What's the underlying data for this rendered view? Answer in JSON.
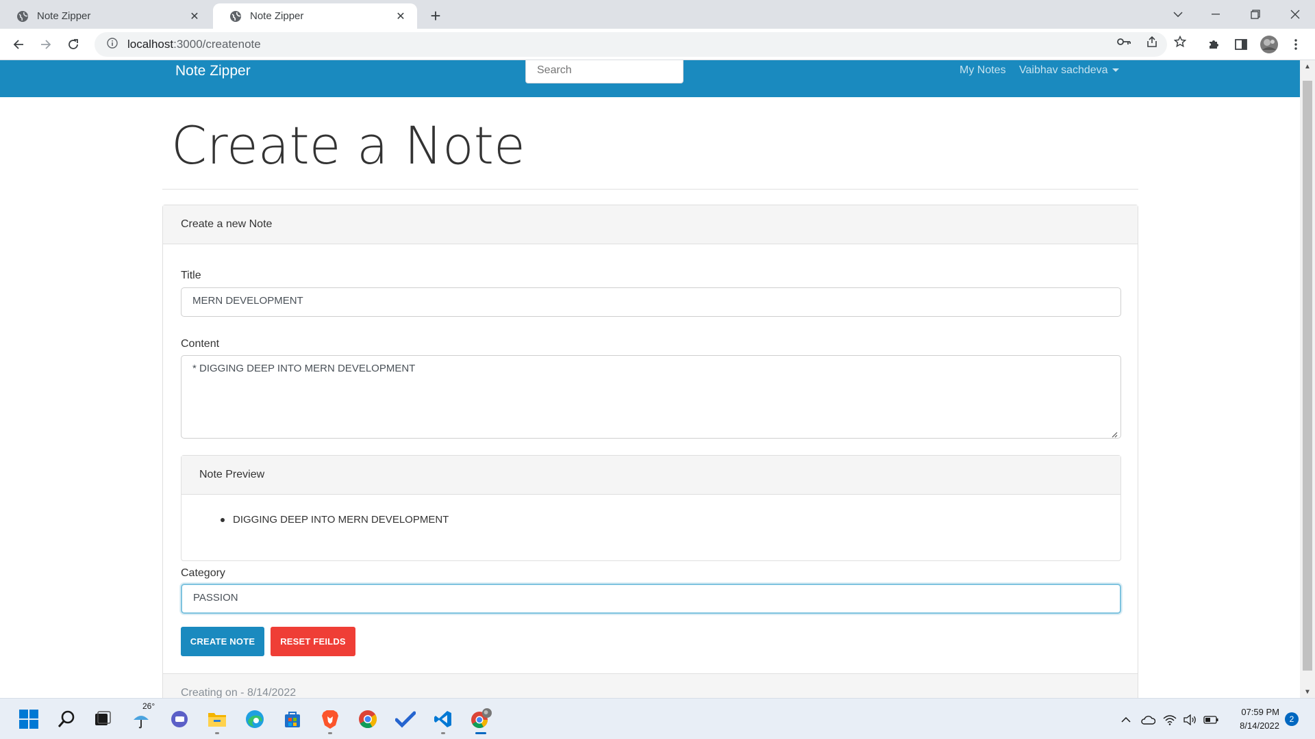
{
  "browser": {
    "tabs": [
      {
        "title": "Note Zipper",
        "active": false
      },
      {
        "title": "Note Zipper",
        "active": true
      }
    ],
    "url_host": "localhost",
    "url_path": ":3000/createnote"
  },
  "navbar": {
    "brand": "Note Zipper",
    "search_placeholder": "Search",
    "my_notes": "My Notes",
    "user_name": "Vaibhav sachdeva"
  },
  "page": {
    "title": "Create a Note",
    "card_header": "Create a new Note",
    "title_label": "Title",
    "title_value": "MERN DEVELOPMENT",
    "content_label": "Content",
    "content_value": "* DIGGING DEEP INTO MERN DEVELOPMENT",
    "preview_header": "Note Preview",
    "preview_items": [
      "DIGGING DEEP INTO MERN DEVELOPMENT"
    ],
    "category_label": "Category",
    "category_value": "PASSION",
    "create_button": "CREATE NOTE",
    "reset_button": "RESET FEILDS",
    "footer_text": "Creating on - 8/14/2022"
  },
  "colors": {
    "navbar": "#1a8abf",
    "primary_button": "#1a8abf",
    "danger_button": "#ef3e36"
  },
  "taskbar": {
    "weather_temp": "26°",
    "time": "07:59 PM",
    "date": "8/14/2022",
    "notification_count": "2",
    "apps": [
      "start-icon",
      "search-icon",
      "task-view-icon",
      "weather-icon",
      "chat-icon",
      "file-explorer-icon",
      "edge-icon",
      "store-icon",
      "brave-icon",
      "chrome-icon",
      "todo-icon",
      "vscode-icon",
      "chrome-profile-icon"
    ]
  }
}
